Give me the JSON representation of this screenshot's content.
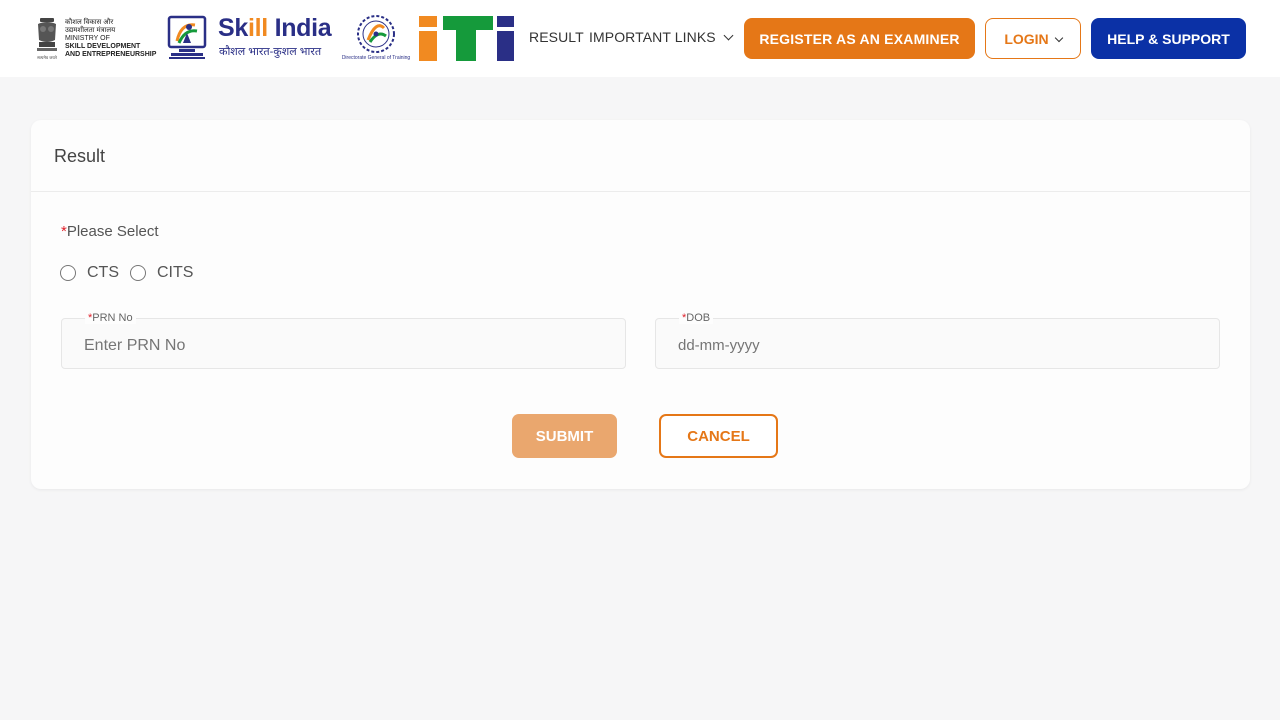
{
  "header": {
    "ministry_logo": {
      "line1": "कौशल विकास और",
      "line2": "उद्यमशीलता मंत्रालय",
      "line3": "MINISTRY OF",
      "line4": "SKILL DEVELOPMENT",
      "line5": "AND ENTREPRENEURSHIP",
      "icon": "national-emblem-icon"
    },
    "computer_logo": {
      "icon": "computer-training-logo-icon"
    },
    "skill_india_logo": {
      "title_part1": "Sk",
      "title_part2": "ill",
      "title_part3": " India",
      "subtitle": "कौशल भारत-कुशल भारत",
      "colors": {
        "primary": "#2a2f86",
        "accent": "#f18a21"
      }
    },
    "dgt_logo": {
      "caption": "Directorate General of Training",
      "icon": "dgt-chakra-icon"
    },
    "iti_logo": {
      "icon": "iti-logo-icon",
      "colors": [
        "#f18a21",
        "#159a3b",
        "#2a2f86"
      ]
    },
    "nav": {
      "result_label": "RESULT",
      "important_links_label": "IMPORTANT LINKS"
    },
    "buttons": {
      "register_label": "REGISTER AS AN EXAMINER",
      "login_label": "LOGIN",
      "help_label": "HELP & SUPPORT"
    },
    "colors": {
      "orange": "#e57717",
      "blue": "#0b31a6"
    }
  },
  "card": {
    "title": "Result",
    "select_label": "Please Select",
    "required_mark": "*",
    "radios": [
      {
        "label": "CTS",
        "checked": false
      },
      {
        "label": "CITS",
        "checked": false
      }
    ],
    "fields": {
      "prn": {
        "label": "PRN No",
        "placeholder": "Enter PRN No",
        "value": ""
      },
      "dob": {
        "label": "DOB",
        "placeholder": "dd-mm-yyyy",
        "value": ""
      }
    },
    "submit_label": "SUBMIT",
    "cancel_label": "CANCEL"
  }
}
